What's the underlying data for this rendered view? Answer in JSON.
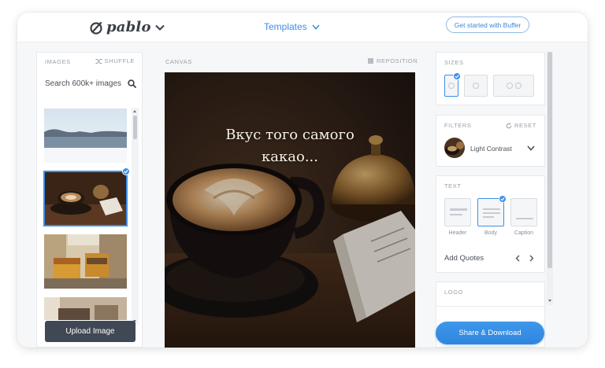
{
  "header": {
    "logo": "pablo",
    "templates_label": "Templates",
    "get_started_label": "Get started with Buffer"
  },
  "images_panel": {
    "title": "IMAGES",
    "shuffle_label": "SHUFFLE",
    "search_placeholder": "Search 600k+ images",
    "upload_label": "Upload Image"
  },
  "canvas": {
    "label": "CANVAS",
    "reposition_label": "REPOSITION",
    "text_line1": "Вкус того самого",
    "text_line2": "какао..."
  },
  "sizes": {
    "title": "SIZES"
  },
  "filters": {
    "title": "FILTERS",
    "reset_label": "RESET",
    "selected": "Light Contrast"
  },
  "text_panel": {
    "title": "TEXT",
    "options": [
      "Header",
      "Body",
      "Caption"
    ],
    "selected": "Body",
    "add_quotes_label": "Add Quotes"
  },
  "logo_panel": {
    "title": "LOGO"
  },
  "share_label": "Share & Download",
  "colors": {
    "accent": "#3d8fe8",
    "upload_button": "#3f4854",
    "share_button": "#3a91e8"
  }
}
